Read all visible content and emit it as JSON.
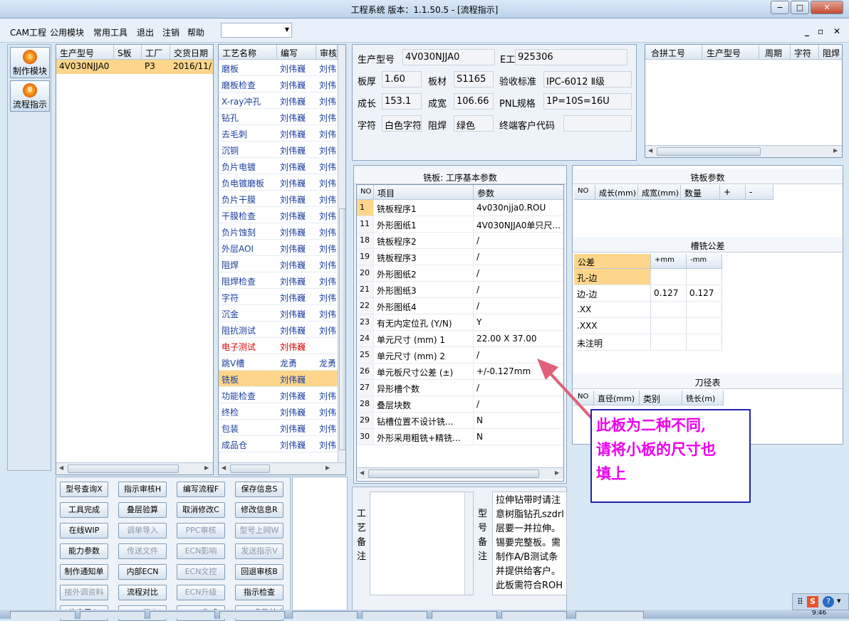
{
  "window": {
    "title": "工程系统   版本：1.1.50.5 - [流程指示]",
    "min": "−",
    "max": "□",
    "close": "✕"
  },
  "menu": {
    "items": [
      "CAM工程",
      "公用模块",
      "常用工具",
      "退出",
      "注销",
      "帮助"
    ],
    "combo_value": "",
    "mdi": [
      "_",
      "▫",
      "✕"
    ]
  },
  "side": {
    "buttons": [
      {
        "label": "制作模块",
        "icon": "flame-icon",
        "glyph": "♨"
      },
      {
        "label": "流程指示",
        "icon": "flow-icon",
        "glyph": "Ⅲ"
      }
    ]
  },
  "order_grid": {
    "headers": [
      "生产型号",
      "S板",
      "工厂",
      "交货日期"
    ],
    "rows": [
      [
        "4V030NJJA0",
        "",
        "P3",
        "2016/11/"
      ]
    ]
  },
  "process_grid": {
    "headers": [
      "工艺名称",
      "编写",
      "审核"
    ],
    "rows": [
      [
        "磨板",
        "刘伟巍",
        "刘伟"
      ],
      [
        "磨板检查",
        "刘伟巍",
        "刘伟"
      ],
      [
        "X-ray冲孔",
        "刘伟巍",
        "刘伟"
      ],
      [
        "钻孔",
        "刘伟巍",
        "刘伟"
      ],
      [
        "去毛刺",
        "刘伟巍",
        "刘伟"
      ],
      [
        "沉铜",
        "刘伟巍",
        "刘伟"
      ],
      [
        "负片电镀",
        "刘伟巍",
        "刘伟"
      ],
      [
        "负电镀磨板",
        "刘伟巍",
        "刘伟"
      ],
      [
        "负片干膜",
        "刘伟巍",
        "刘伟"
      ],
      [
        "干膜检查",
        "刘伟巍",
        "刘伟"
      ],
      [
        "负片蚀刻",
        "刘伟巍",
        "刘伟"
      ],
      [
        "外层AOI",
        "刘伟巍",
        "刘伟"
      ],
      [
        "阻焊",
        "刘伟巍",
        "刘伟"
      ],
      [
        "阻焊检查",
        "刘伟巍",
        "刘伟"
      ],
      [
        "字符",
        "刘伟巍",
        "刘伟"
      ],
      [
        "沉金",
        "刘伟巍",
        "刘伟"
      ],
      [
        "阻抗测试",
        "刘伟巍",
        "刘伟"
      ],
      [
        "电子测试",
        "刘伟巍",
        ""
      ],
      [
        "跳V槽",
        "龙勇",
        "龙勇"
      ],
      [
        "铣板",
        "刘伟巍",
        ""
      ],
      [
        "功能检查",
        "刘伟巍",
        "刘伟"
      ],
      [
        "终检",
        "刘伟巍",
        "刘伟"
      ],
      [
        "包装",
        "刘伟巍",
        "刘伟"
      ],
      [
        "成品仓",
        "刘伟巍",
        "刘伟"
      ]
    ],
    "red_row": 17,
    "selected_row": 19
  },
  "info": {
    "labels": [
      "生产型号",
      "E工号",
      "板厚",
      "板材",
      "验收标准",
      "成长",
      "成宽",
      "PNL规格",
      "字符",
      "阻焊",
      "终端客户代码"
    ],
    "values": [
      "4V030NJJA0",
      "925306",
      "1.60",
      "S1165",
      "IPC-6012 Ⅱ级",
      "153.1",
      "106.66",
      "1P=10S=16U",
      "白色字符",
      "绿色",
      ""
    ]
  },
  "merge_grid": {
    "headers": [
      "合拼工号",
      "生产型号",
      "周期",
      "字符",
      "阻焊"
    ]
  },
  "mill_params": {
    "title": "铣板: 工序基本参数",
    "headers": [
      "NO",
      "项目",
      "参数"
    ],
    "rows": [
      [
        "1",
        "铣板程序1",
        "4v030njja0.ROU"
      ],
      [
        "11",
        "外形图纸1",
        "4V030NJJA0单只尺..."
      ],
      [
        "18",
        "铣板程序2",
        "/"
      ],
      [
        "19",
        "铣板程序3",
        "/"
      ],
      [
        "20",
        "外形图纸2",
        "/"
      ],
      [
        "21",
        "外形图纸3",
        "/"
      ],
      [
        "22",
        "外形图纸4",
        "/"
      ],
      [
        "23",
        "有无内定位孔 (Y/N)",
        "Y"
      ],
      [
        "24",
        "单元尺寸 (mm) 1",
        "22.00 X 37.00"
      ],
      [
        "25",
        "单元尺寸 (mm) 2",
        "/"
      ],
      [
        "26",
        "单元板尺寸公差 (±)",
        "+/-0.127mm"
      ],
      [
        "27",
        "异形槽个数",
        "/"
      ],
      [
        "28",
        "叠层块数",
        "/"
      ],
      [
        "29",
        "钻槽位置不设计铣...",
        "N"
      ],
      [
        "30",
        "外形采用粗铣+精铣...",
        "N"
      ]
    ]
  },
  "mill_board": {
    "title": "铣板参数",
    "headers": [
      "NO",
      "成长(mm)",
      "成宽(mm)",
      "数量",
      "+",
      "-"
    ]
  },
  "slot_tol": {
    "title": "槽铣公差",
    "headers": [
      "公差",
      "+mm",
      "-mm"
    ],
    "rows": [
      [
        "孔-边",
        "",
        ""
      ],
      [
        "边-边",
        "0.127",
        "0.127"
      ],
      [
        ".XX",
        "",
        ""
      ],
      [
        ".XXX",
        "",
        ""
      ],
      [
        "未注明",
        "",
        ""
      ]
    ]
  },
  "tool_table": {
    "title": "刀径表",
    "headers": [
      "NO",
      "直径(mm)",
      "类别",
      "铣长(m)"
    ]
  },
  "buttons": [
    [
      "型号查询X",
      "指示审核H",
      "编写流程F",
      "保存信息S"
    ],
    [
      "工具完成",
      "叠层验算",
      "取消修改C",
      "修改信息R"
    ],
    [
      "在线WIP",
      "调单导入",
      "PPC审核",
      "型号上网W"
    ],
    [
      "能力参数",
      "传送文件",
      "ECN影响",
      "发送指示V"
    ],
    [
      "制作通知单",
      "内部ECN",
      "ECN文控",
      "回退审核B"
    ],
    [
      "接外调资料",
      "流程对比",
      "ECN升级",
      "指示检查"
    ],
    [
      "信息导入",
      "MES同步",
      "BOM生成",
      "BOM参数检查"
    ]
  ],
  "disabled_buttons": [
    "调单导入",
    "PPC审核",
    "型号上网W",
    "传送文件",
    "ECN影响",
    "发送指示V",
    "ECN文控",
    "接外调资料",
    "ECN升级",
    "MES同步"
  ],
  "notes": {
    "process_label": "工艺备注",
    "model_label": "型号备注",
    "model_text": "拉伸钻带时请注意树脂钻孔szdrl层要一并拉伸。锡要完整板。需制作A/B测试条并提供给客户。此板需符合ROHS标准。才"
  },
  "callout": {
    "lines": [
      "此板为二种不同,",
      "请将小板的尺寸也",
      "填上"
    ]
  },
  "tray": {
    "clock": "9:46"
  }
}
